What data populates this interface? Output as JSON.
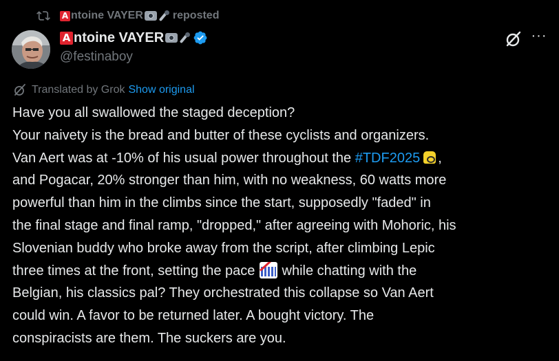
{
  "repost": {
    "badge_letter": "A",
    "name_rest": "ntoine VAYER",
    "label": "reposted",
    "icon": "repost-icon"
  },
  "author": {
    "badge_letter": "A",
    "name_rest": "ntoine VAYER",
    "handle": "@festinaboy",
    "verified_icon": "verified-badge-icon",
    "emojis": [
      "camera-emoji",
      "microphone-emoji"
    ]
  },
  "actions": {
    "grok_icon": "grok-icon",
    "more_label": "···"
  },
  "translation": {
    "label": "Translated by Grok",
    "link": "Show original",
    "icon": "grok-icon"
  },
  "body": {
    "line1": "Have you all swallowed the staged deception?",
    "line2": "Your naivety is the bread and butter of these cyclists and organizers.",
    "line3_before": "Van Aert was at -10% of his usual power throughout the ",
    "hashtag": "#TDF2025",
    "line3_after": ",",
    "line4": "and Pogacar, 20% stronger than him, with no weakness, 60 watts more",
    "line5": "powerful than him in the climbs since the start, supposedly \"faded\" in",
    "line6": "the final stage and final ramp, \"dropped,\" after agreeing with Mohoric, his",
    "line7": "Slovenian buddy who broke away from the script, after climbing Lepic",
    "line8_before": "three times at the front, setting the pace ",
    "line8_after": " while chatting with the",
    "line9": "Belgian, his classics pal? They orchestrated this collapse so Van Aert",
    "line10": "could win. A favor to be returned later. A bought victory. The",
    "line11": "conspiracists are them. The suckers are you."
  },
  "colors": {
    "background": "#000000",
    "text": "#e7e9ea",
    "muted": "#71767b",
    "link": "#1d9bf0",
    "verified": "#1d9bf0",
    "badge": "#e0242f"
  }
}
